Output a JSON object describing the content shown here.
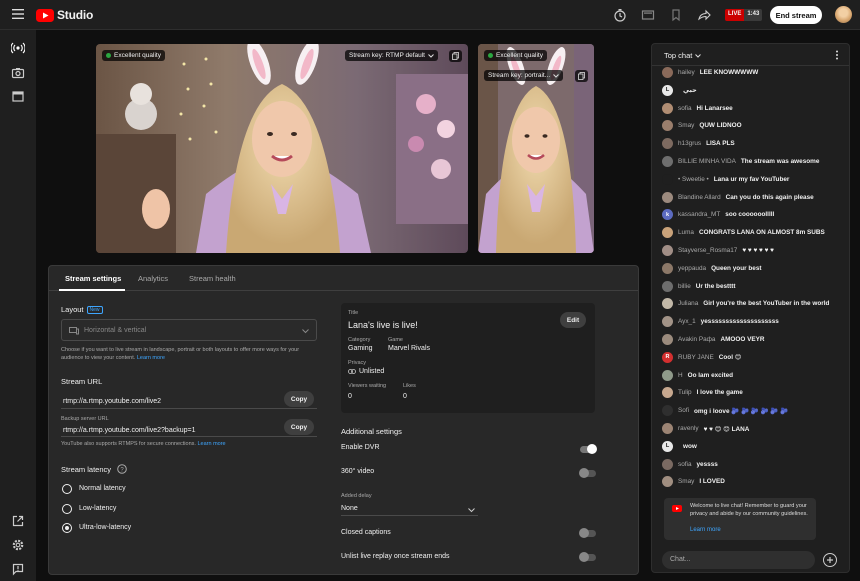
{
  "app": {
    "logo_text": "Studio"
  },
  "topbar": {
    "live_label": "LIVE",
    "live_time": "1:43",
    "end_stream_label": "End stream"
  },
  "previews": {
    "main": {
      "quality": "Excellent quality",
      "stream_key": "Stream key: RTMP default"
    },
    "vertical": {
      "quality": "Excellent quality",
      "stream_key": "Stream key: portrait..."
    }
  },
  "tabs": [
    "Stream settings",
    "Analytics",
    "Stream health"
  ],
  "layout": {
    "label": "Layout",
    "badge": "New",
    "selected": "Horizontal & vertical",
    "help": "Choose if you want to live stream in landscape, portrait or both layouts to offer more ways for your audience to view your content.",
    "learn_more": "Learn more"
  },
  "stream_url": {
    "label": "Stream URL",
    "value": "rtmp://a.rtmp.youtube.com/live2",
    "copy": "Copy",
    "backup_label": "Backup server URL",
    "backup_value": "rtmp://a.rtmp.youtube.com/live2?backup=1",
    "backup_copy": "Copy",
    "note": "YouTube also supports RTMPS for secure connections.",
    "note_link": "Learn more"
  },
  "latency": {
    "label": "Stream latency",
    "options": [
      "Normal latency",
      "Low-latency",
      "Ultra-low-latency"
    ],
    "selected_index": 2
  },
  "details": {
    "title_label": "Title",
    "title": "Lana's live is live!",
    "edit": "Edit",
    "category_label": "Category",
    "category": "Gaming",
    "game_label": "Game",
    "game": "Marvel Rivals",
    "privacy_label": "Privacy",
    "privacy": "Unlisted",
    "viewers_label": "Viewers waiting",
    "viewers": "0",
    "likes_label": "Likes",
    "likes": "0"
  },
  "additional": {
    "label": "Additional settings",
    "dvr": "Enable DVR",
    "dvr_on": true,
    "video360": "360° video",
    "video360_on": false,
    "delay_label": "Added delay",
    "delay_value": "None",
    "captions": "Closed captions",
    "captions_on": false,
    "unlist": "Unlist live replay once stream ends",
    "unlist_on": false
  },
  "chat": {
    "header": "Top chat",
    "messages": [
      {
        "author": "hailey",
        "text": "LEE KNOWWWWW",
        "avatar": "",
        "color": "#8a6a5a"
      },
      {
        "author": "",
        "text": "حبي",
        "avatar": "L",
        "color": "#e8e8e8"
      },
      {
        "author": "sofia",
        "text": "Hi Lanarsee",
        "avatar": "",
        "color": "#b08d73"
      },
      {
        "author": "Smay",
        "text": "QUW LIDNOO",
        "avatar": "",
        "color": "#9a7e6c"
      },
      {
        "author": "h13grus",
        "text": "LISA PLS",
        "avatar": "",
        "color": "#7d6a60"
      },
      {
        "author": "BILLIE MINHA VIDA",
        "text": "The stream was awesome",
        "avatar": "",
        "color": "#6e6e6e"
      },
      {
        "author": "• Sweetie •",
        "text": "Lana ur my fav YouTuber",
        "avatar": "",
        "color": "#1f1f1f"
      },
      {
        "author": "Blandine Allard",
        "text": "Can you do this again please",
        "avatar": "",
        "color": "#9c8a7e"
      },
      {
        "author": "kassandra_MT",
        "text": "soo coooooolllll",
        "avatar": "k",
        "color": "#5c6bc0"
      },
      {
        "author": "Luma",
        "text": "CONGRATS LANA ON ALMOST 8m SUBS",
        "avatar": "",
        "color": "#c9a27a"
      },
      {
        "author": "Stayverse_Rosma17",
        "text": "♥ ♥ ♥ ♥ ♥ ♥",
        "avatar": "",
        "color": "#a18e86"
      },
      {
        "author": "yeppauda",
        "text": "Queen your best",
        "avatar": "",
        "color": "#8c7868"
      },
      {
        "author": "billie",
        "text": "Ur the bestttt",
        "avatar": "",
        "color": "#6d6d6d"
      },
      {
        "author": "Juliana",
        "text": "Girl you're the best YouTuber in the world",
        "avatar": "",
        "color": "#c2b8a8"
      },
      {
        "author": "Ayx_1",
        "text": "yessssssssssssssssssss",
        "avatar": "",
        "color": "#a29387"
      },
      {
        "author": "Avakin Paфa",
        "text": "AMOOO VEYR",
        "avatar": "",
        "color": "#9b8b7d"
      },
      {
        "author": "RUBY JANE",
        "text": "Cool 😊",
        "avatar": "R",
        "color": "#d32f2f"
      },
      {
        "author": "H",
        "text": "Oo lam excited",
        "avatar": "",
        "color": "#8f9a8a"
      },
      {
        "author": "Tulip",
        "text": "I love the game",
        "avatar": "",
        "color": "#c7a88f"
      },
      {
        "author": "Sofi",
        "text": "omg i loove 🫐 🫐 🫐 🫐 🫐 🫐",
        "avatar": "",
        "color": "#2f2f2f"
      },
      {
        "author": "ravenly",
        "text": "♥ ♥ 😊 😊 LANA",
        "avatar": "",
        "color": "#9c8474"
      },
      {
        "author": "",
        "text": "wow",
        "avatar": "L",
        "color": "#e8e8e8"
      },
      {
        "author": "sofia",
        "text": "yessss",
        "avatar": "",
        "color": "#7a6a62"
      },
      {
        "author": "Smay",
        "text": "I LOVED",
        "avatar": "",
        "color": "#a08e80"
      }
    ],
    "welcome": "Welcome to live chat! Remember to guard your privacy and abide by our community guidelines.",
    "welcome_link": "Learn more",
    "input_placeholder": "Chat..."
  },
  "colors": {
    "accent_red": "#ff0000",
    "link": "#3ea6ff",
    "bg": "#0f0f0f",
    "panel": "#282828"
  }
}
